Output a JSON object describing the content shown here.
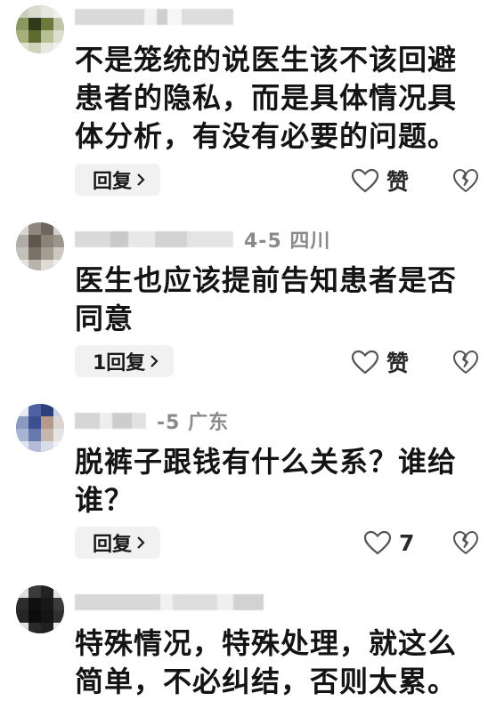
{
  "comments": [
    {
      "info": "",
      "text_lines": [
        "不是笼统的说医生该不该回避",
        "患者的隐私，而是具体情况具",
        "体分析，有没有必要的问题。"
      ],
      "reply_label": "回复",
      "like_label": "赞"
    },
    {
      "info": "4-5 四川",
      "text_lines": [
        "医生也应该提前告知患者是否",
        "同意"
      ],
      "reply_label": "1回复",
      "like_label": "赞"
    },
    {
      "info": "-5 广东",
      "text_lines": [
        "脱裤子跟钱有什么关系？谁给",
        "谁？"
      ],
      "reply_label": "回复",
      "like_label": "7"
    },
    {
      "info": "",
      "text_lines": [
        "特殊情况，特殊处理，就这么",
        "简单，不必纠结，否则太累。"
      ],
      "reply_label": "",
      "like_label": ""
    }
  ],
  "icons": {
    "like": "heart-outline-icon",
    "dislike": "broken-heart-icon",
    "chevron": "chevron-right-icon"
  },
  "colors": {
    "text": "#141414",
    "meta": "#8a8a8a",
    "reply_bg": "#f1f1f1",
    "icon": "#555555"
  }
}
